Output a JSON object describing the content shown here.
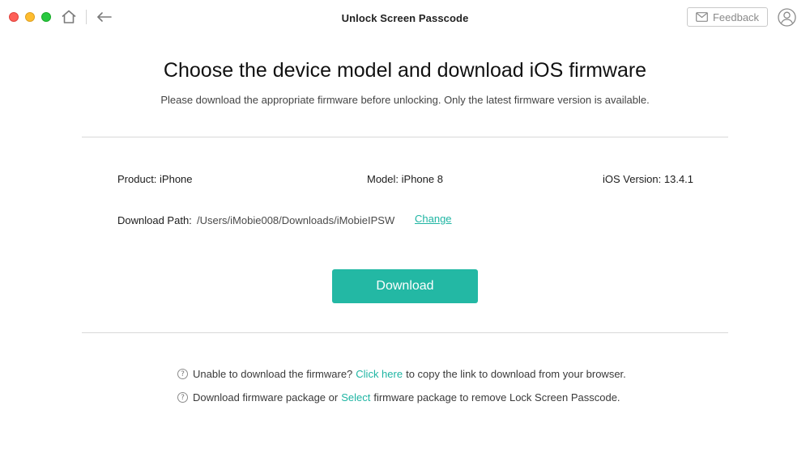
{
  "window": {
    "title": "Unlock Screen Passcode",
    "feedback_label": "Feedback"
  },
  "page": {
    "heading": "Choose the device model and download iOS firmware",
    "subheading": "Please download the appropriate firmware before unlocking. Only the latest firmware version is available."
  },
  "device": {
    "product": "Product: iPhone",
    "model": "Model: iPhone 8",
    "ios_version": "iOS Version: 13.4.1"
  },
  "download_path": {
    "label": "Download Path:",
    "value": "/Users/iMobie008/Downloads/iMobieIPSW",
    "change_label": "Change"
  },
  "download_button": {
    "label": "Download"
  },
  "help": {
    "icon": "?",
    "line1": {
      "before": "Unable to download the firmware?",
      "link": "Click here",
      "after": "to copy the link to download from your browser."
    },
    "line2": {
      "before": "Download firmware package or",
      "link": "Select",
      "after": "firmware package to remove Lock Screen Passcode."
    }
  },
  "colors": {
    "accent": "#23b8a4",
    "link": "#1fb5a3",
    "close": "#fe5f57",
    "minimize": "#febc2e",
    "maximize": "#28c840"
  }
}
